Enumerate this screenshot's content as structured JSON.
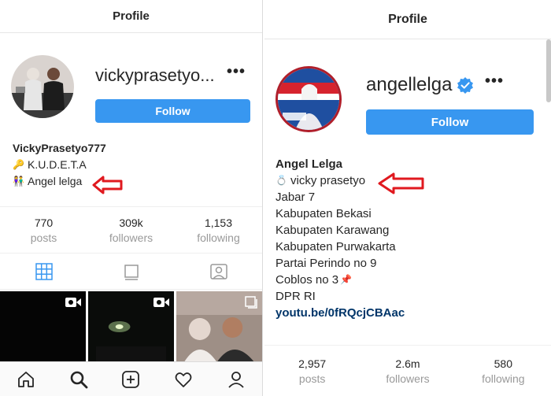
{
  "left": {
    "title": "Profile",
    "username": "vickyprasetyo...",
    "follow_label": "Follow",
    "bio": {
      "name": "VickyPrasetyo777",
      "line1": "K.U.D.E.T.A",
      "line2": "Angel lelga"
    },
    "stats": [
      {
        "value": "770",
        "label": "posts"
      },
      {
        "value": "309k",
        "label": "followers"
      },
      {
        "value": "1,153",
        "label": "following"
      }
    ]
  },
  "right": {
    "title": "Profile",
    "username": "angellelga",
    "follow_label": "Follow",
    "bio": {
      "name": "Angel Lelga",
      "mention": "vicky prasetyo",
      "lines": [
        "Jabar 7",
        "Kabupaten Bekasi",
        "Kabupaten Karawang",
        "Kabupaten Purwakarta",
        "Partai Perindo no 9",
        "Coblos no 3",
        "DPR RI"
      ],
      "link": "youtu.be/0fRQcjCBAac"
    },
    "stats": [
      {
        "value": "2,957",
        "label": "posts"
      },
      {
        "value": "2.6m",
        "label": "followers"
      },
      {
        "value": "580",
        "label": "following"
      }
    ]
  },
  "colors": {
    "accent": "#3897f0",
    "arrow": "#e0191f",
    "verified": "#3897f0",
    "link": "#003569"
  },
  "icons": [
    "more-dots-icon",
    "key-icon",
    "couple-emoji-icon",
    "ring-emoji-icon",
    "pin-emoji-icon",
    "verified-badge-icon",
    "grid-icon",
    "feed-icon",
    "tagged-icon",
    "video-icon",
    "home-icon",
    "search-icon",
    "add-icon",
    "heart-icon",
    "profile-icon",
    "red-arrow-icon"
  ]
}
